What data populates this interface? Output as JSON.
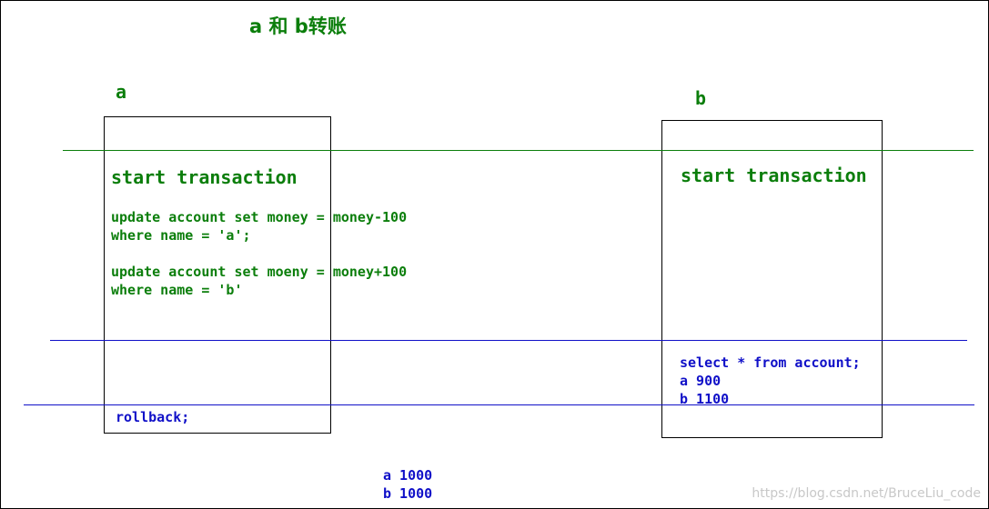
{
  "title": "a 和 b转账",
  "panel_a": {
    "label": "a",
    "start": "start transaction",
    "stmt1_line1": "update account set money = money-100",
    "stmt1_line2": "where name = 'a';",
    "stmt2_line1": "update account set moeny = money+100",
    "stmt2_line2": "where name = 'b'",
    "rollback": "rollback;"
  },
  "panel_b": {
    "label": "b",
    "start": "start transaction",
    "select": "select * from account;",
    "row1": "a 900",
    "row2": "b 1100"
  },
  "after": {
    "row1": "a 1000",
    "row2": "b 1000"
  },
  "watermark": "https://blog.csdn.net/BruceLiu_code",
  "colors": {
    "green": "#0b7e0b",
    "blue": "#1010c8",
    "border": "#000000"
  }
}
